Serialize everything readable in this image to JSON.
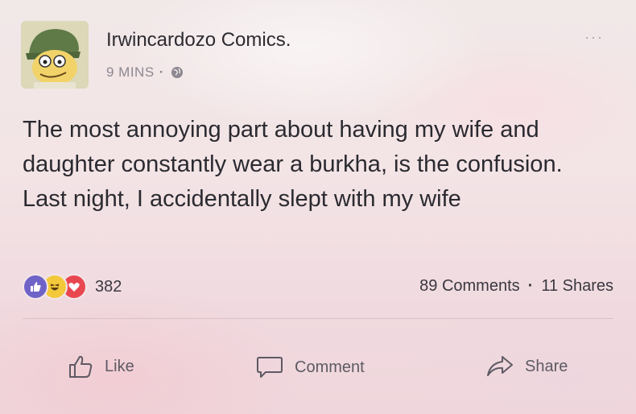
{
  "post": {
    "author": "Irwincardozo Comics.",
    "time": "9 MINS",
    "meta_separator": "·",
    "more_menu": "···",
    "body_lines": [
      "The most annoying part about having my wife and daughter constantly wear a burkha, is the confusion.",
      "Last night, I accidentally slept with my wife"
    ]
  },
  "reactions": {
    "icons": [
      "like-reaction-icon",
      "haha-reaction-icon",
      "love-reaction-icon"
    ],
    "count": "382"
  },
  "stats": {
    "comments": "89 Comments",
    "separator": "·",
    "shares": "11 Shares"
  },
  "actions": {
    "like_label": "Like",
    "comment_label": "Comment",
    "share_label": "Share"
  },
  "colors": {
    "like_reaction": "#6f63c8",
    "haha_reaction": "#f3c83a",
    "love_reaction": "#e9474f",
    "text": "#2a2a30",
    "muted": "#8d8890"
  }
}
